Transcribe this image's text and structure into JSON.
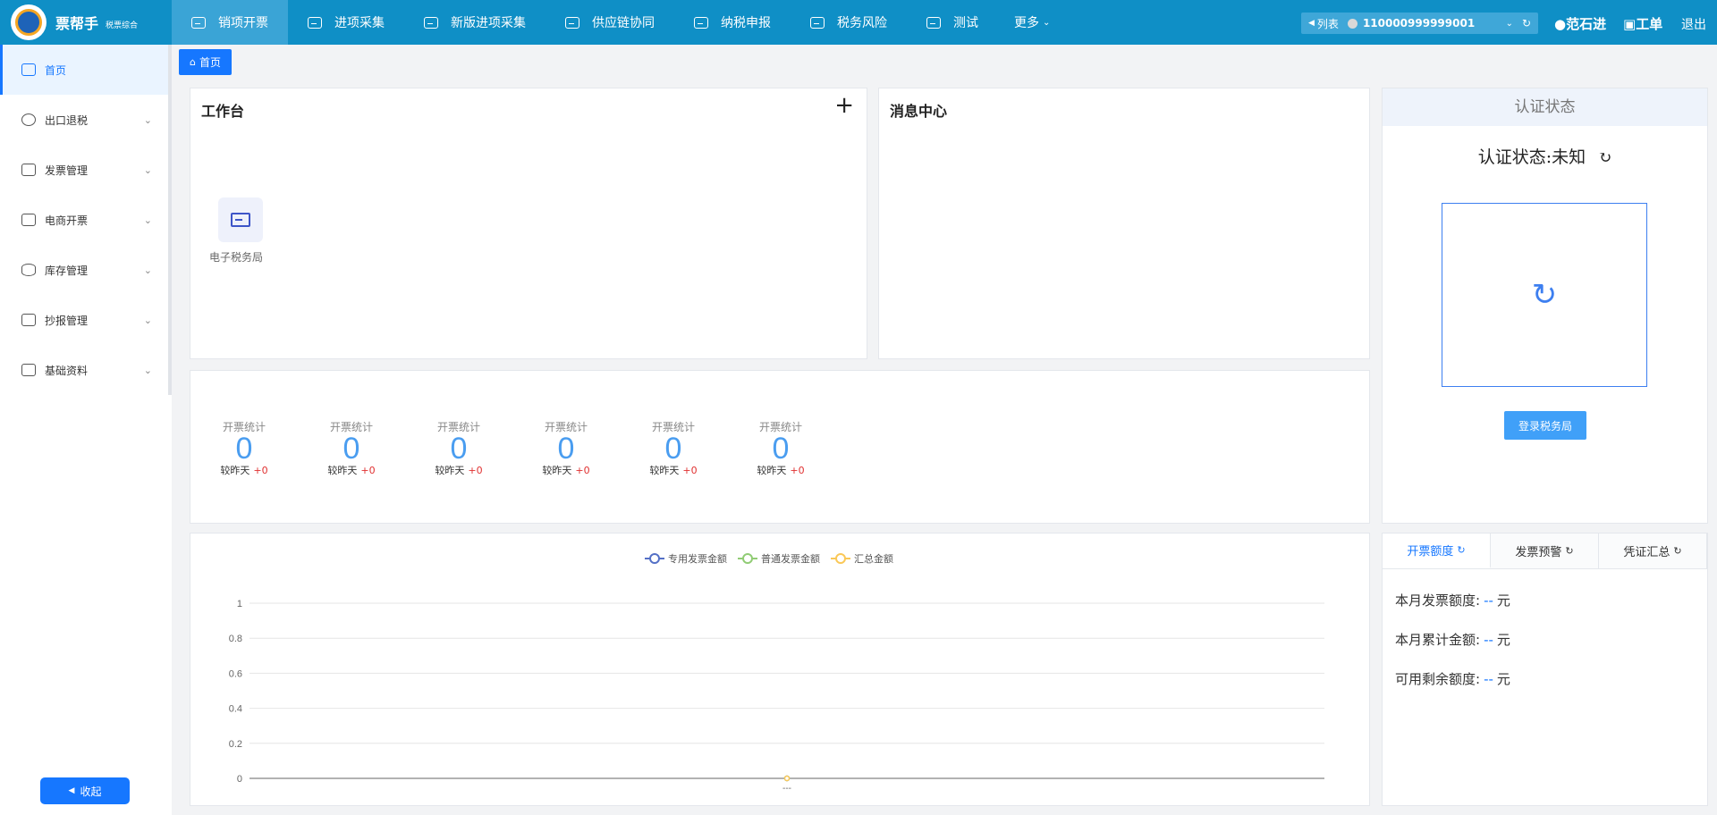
{
  "brand": {
    "title": "票帮手",
    "subtitle": "税票综合"
  },
  "nav": {
    "items": [
      "销项开票",
      "进项采集",
      "新版进项采集",
      "供应链协同",
      "纳税申报",
      "税务风险",
      "测试"
    ],
    "more": "更多"
  },
  "account": {
    "list_label": "列表",
    "tax_number": "110000999999001"
  },
  "user": {
    "name": "范石进",
    "ticket": "工单",
    "logout": "退出"
  },
  "sidebar": {
    "items": [
      "首页",
      "出口退税",
      "发票管理",
      "电商开票",
      "库存管理",
      "抄报管理",
      "基础资料"
    ],
    "collapse": "收起"
  },
  "breadcrumb": {
    "home": "首页"
  },
  "workbench": {
    "title": "工作台",
    "tile_label": "电子税务局"
  },
  "messages": {
    "title": "消息中心"
  },
  "stats": {
    "items": [
      {
        "label": "开票统计",
        "value": "0",
        "sub": "较昨天",
        "delta": "+0"
      },
      {
        "label": "开票统计",
        "value": "0",
        "sub": "较昨天",
        "delta": "+0"
      },
      {
        "label": "开票统计",
        "value": "0",
        "sub": "较昨天",
        "delta": "+0"
      },
      {
        "label": "开票统计",
        "value": "0",
        "sub": "较昨天",
        "delta": "+0"
      },
      {
        "label": "开票统计",
        "value": "0",
        "sub": "较昨天",
        "delta": "+0"
      },
      {
        "label": "开票统计",
        "value": "0",
        "sub": "较昨天",
        "delta": "+0"
      }
    ]
  },
  "auth": {
    "header": "认证状态",
    "status": "认证状态:未知",
    "login_button": "登录税务局"
  },
  "quota": {
    "tabs": [
      "开票额度",
      "发票预警",
      "凭证汇总"
    ],
    "rows": [
      {
        "label": "本月发票额度:",
        "value": "--",
        "unit": "元"
      },
      {
        "label": "本月累计金额:",
        "value": "--",
        "unit": "元"
      },
      {
        "label": "可用剩余额度:",
        "value": "--",
        "unit": "元"
      }
    ]
  },
  "chart_data": {
    "type": "line",
    "categories": [
      "---"
    ],
    "series": [
      {
        "name": "专用发票金额",
        "values": [
          0
        ],
        "color": "#5470c6"
      },
      {
        "name": "普通发票金额",
        "values": [
          0
        ],
        "color": "#91cc75"
      },
      {
        "name": "汇总金额",
        "values": [
          0
        ],
        "color": "#fac858"
      }
    ],
    "ylim": [
      0,
      1
    ],
    "yticks": [
      "1",
      "0.8",
      "0.6",
      "0.4",
      "0.2",
      "0"
    ],
    "legend": "top-center",
    "grid": true
  }
}
